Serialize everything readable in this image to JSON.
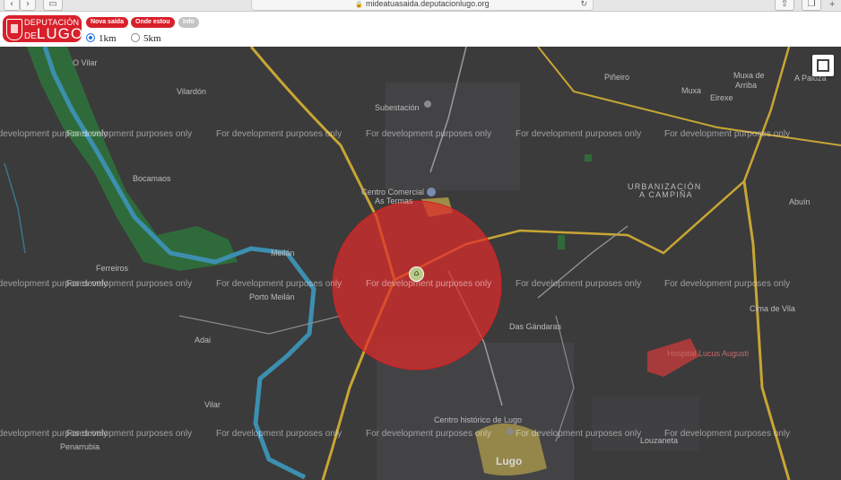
{
  "browser": {
    "url": "mideatuasaida.deputacionlugo.org",
    "back": "‹",
    "forward": "›"
  },
  "logo": {
    "line1": "DEPUTACIÓN",
    "line2_small": "DE",
    "line2_big": "LUGO"
  },
  "toolbar": {
    "nova_saida": "Nova saída",
    "onde_estou": "Onde estou",
    "info": "Info"
  },
  "radius": {
    "selected": "1km",
    "options": [
      "1km",
      "5km"
    ]
  },
  "map": {
    "watermark": "For development purposes only",
    "circle_color": "#e02b2b",
    "places": [
      {
        "name": "O Vilar"
      },
      {
        "name": "Vilardón"
      },
      {
        "name": "Subestación"
      },
      {
        "name": "Piñeiro"
      },
      {
        "name": "Muxa de"
      },
      {
        "name": "Arriba"
      },
      {
        "name": "Muxa"
      },
      {
        "name": "Eirexe"
      },
      {
        "name": "A Paloza"
      },
      {
        "name": "Bocamaos"
      },
      {
        "name": "Centro Comercial"
      },
      {
        "name": "As Termas"
      },
      {
        "name": "URBANIZACIÓN"
      },
      {
        "name": "A CAMPIÑA"
      },
      {
        "name": "Abuín"
      },
      {
        "name": "Ferreiros"
      },
      {
        "name": "Meilán"
      },
      {
        "name": "Porto Meilán"
      },
      {
        "name": "Cima de Vila"
      },
      {
        "name": "Das Gándaras"
      },
      {
        "name": "Adai"
      },
      {
        "name": "Hospital Lucus Augusti"
      },
      {
        "name": "Vilar"
      },
      {
        "name": "Centro histórico de Lugo"
      },
      {
        "name": "Penarrubia"
      },
      {
        "name": "Louzaneta"
      },
      {
        "name": "Lugo"
      }
    ]
  }
}
